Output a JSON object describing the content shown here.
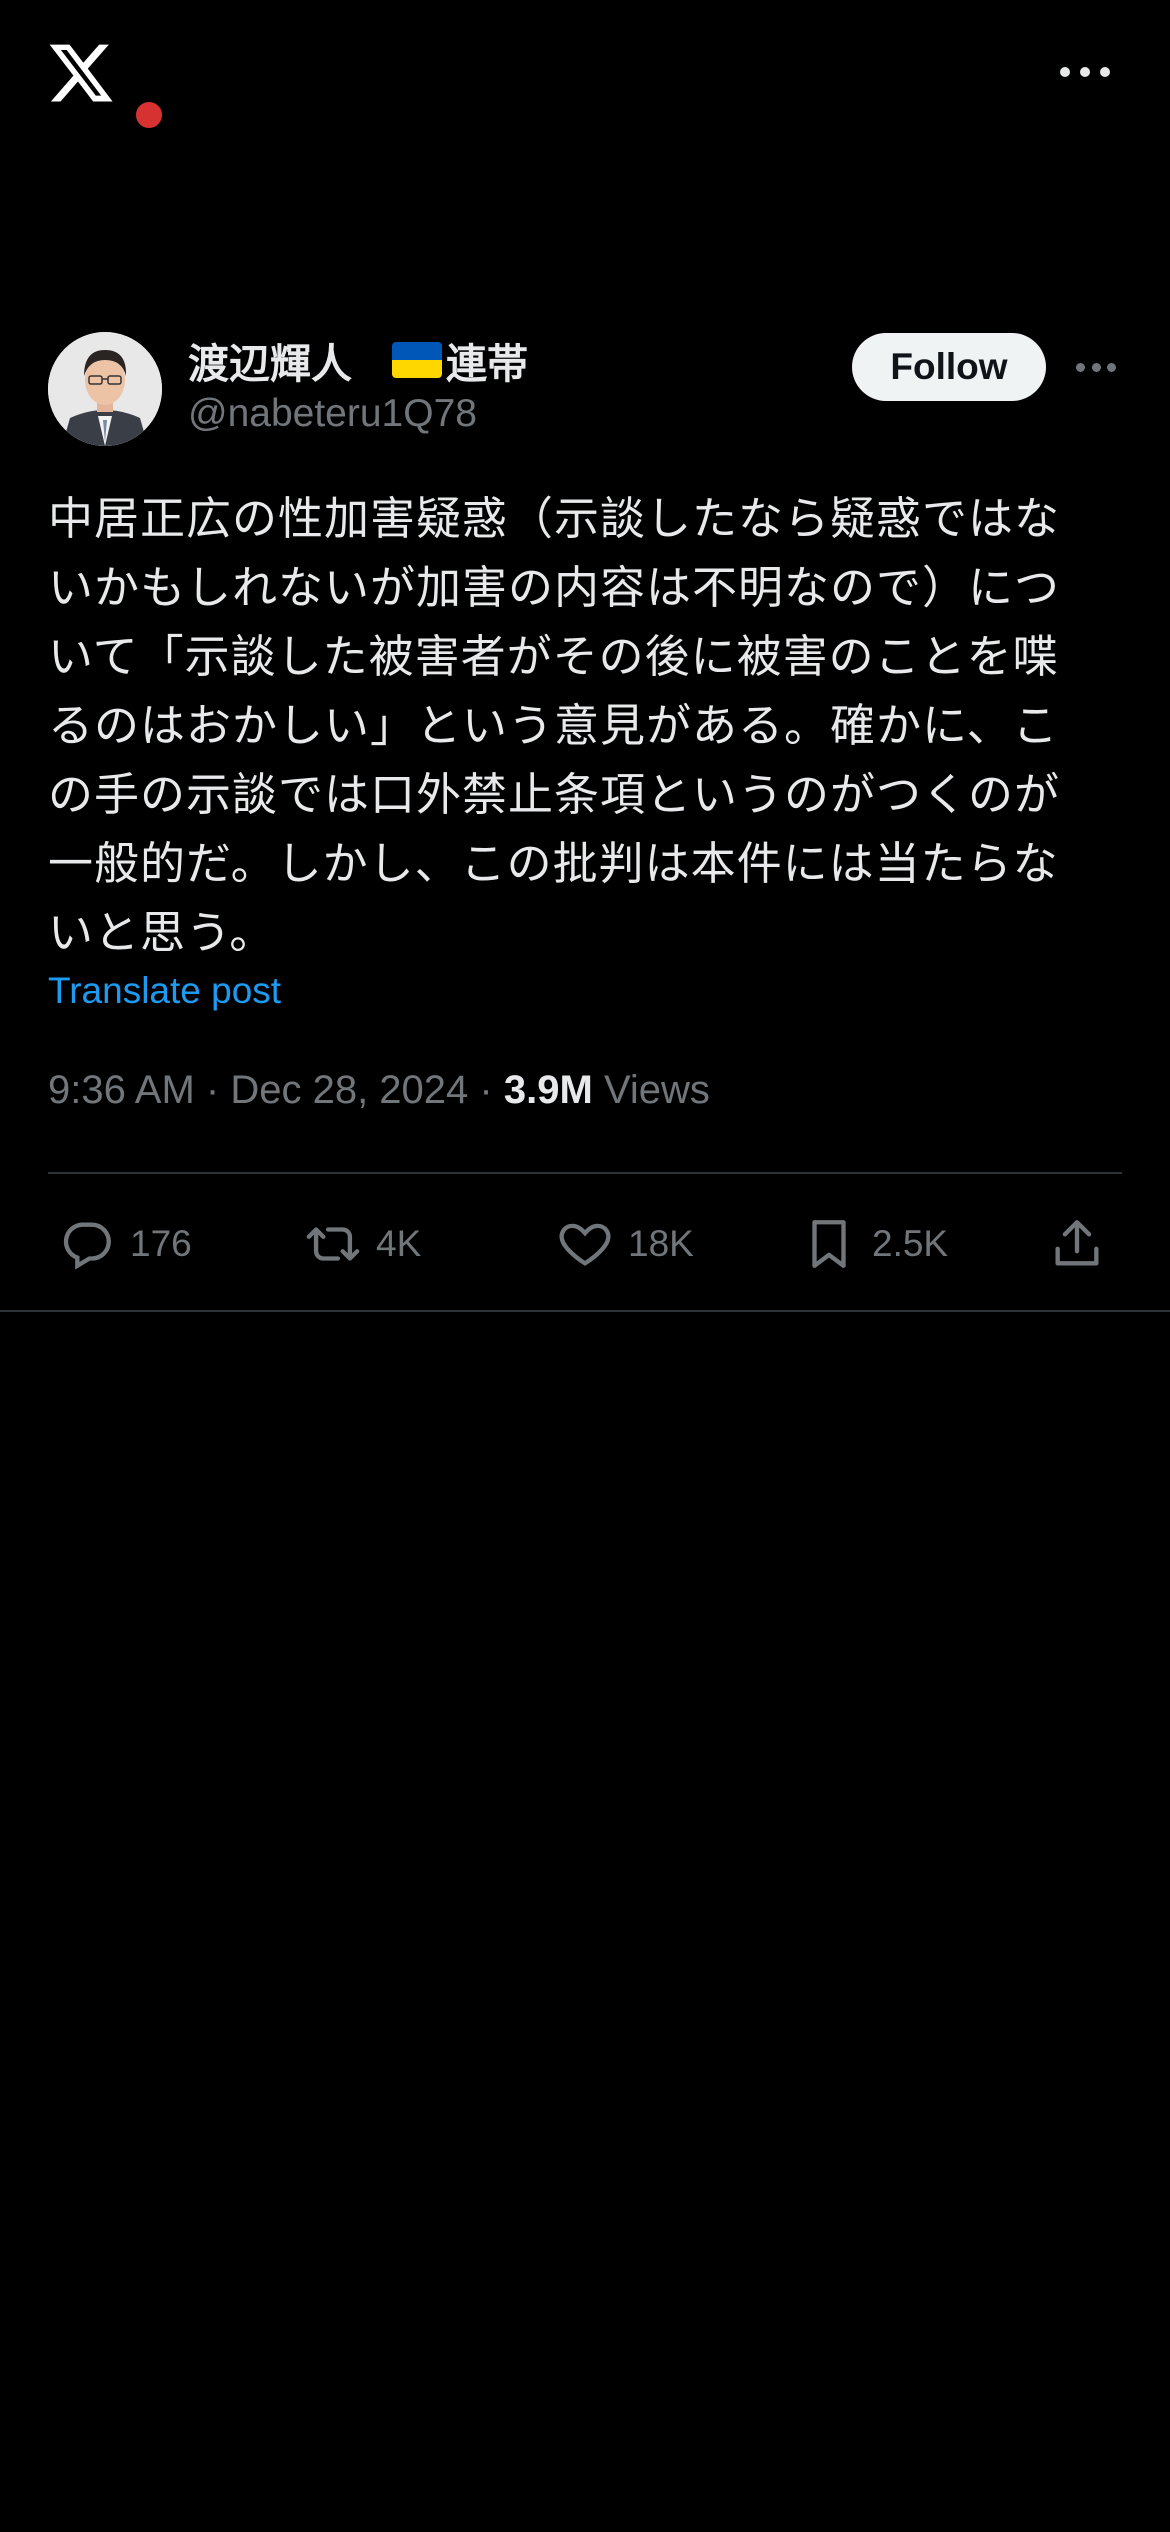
{
  "topbar": {
    "logo_icon": "x-logo-icon",
    "more_icon": "more-horizontal-icon"
  },
  "post": {
    "author": {
      "display_name": "渡辺輝人",
      "name_suffix": "連帯",
      "flag_icon": "ukraine-flag-icon",
      "handle": "@nabeteru1Q78"
    },
    "follow_label": "Follow",
    "text_lines": [
      "中居正広の性加害疑惑（示談したなら疑惑ではな",
      "いかもしれないが加害の内容は不明なので）につ",
      "いて「示談した被害者がその後に被害のことを喋",
      "るのはおかしい」という意見がある。確かに、こ",
      "の手の示談では口外禁止条項というのがつくのが",
      "一般的だ。しかし、この批判は本件には当たらな",
      "いと思う。"
    ],
    "translate_label": "Translate post",
    "time": "9:36 AM",
    "date": "Dec 28, 2024",
    "separator": "·",
    "views_count": "3.9M",
    "views_label": "Views",
    "actions": {
      "replies": "176",
      "reposts": "4K",
      "likes": "18K",
      "bookmarks": "2.5K"
    }
  },
  "colors": {
    "background": "#000000",
    "text": "#e7e9ea",
    "muted": "#71767b",
    "link": "#1d9bf0",
    "divider": "#2f3336"
  }
}
